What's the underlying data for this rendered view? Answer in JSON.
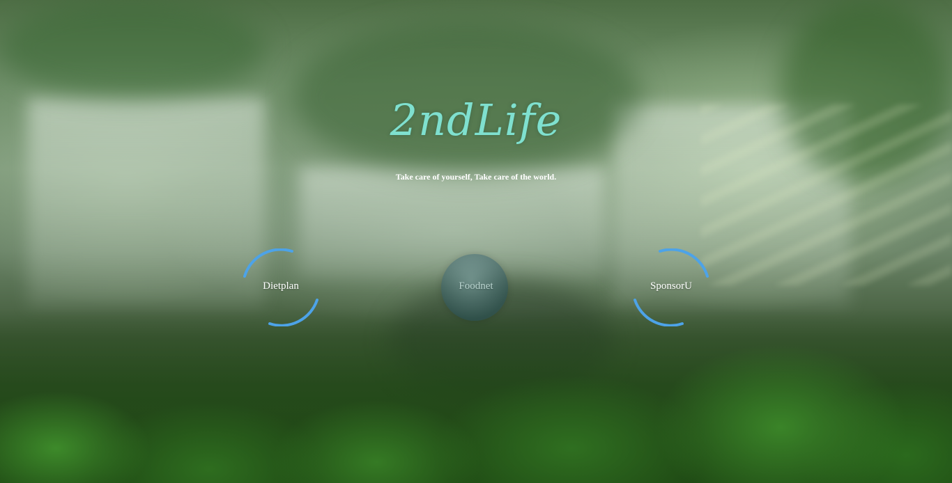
{
  "brand": {
    "logo_text": "2ndLife",
    "tagline": "Take care of yourself, Take care of the world."
  },
  "nav": {
    "items": [
      {
        "label": "Dietplan"
      },
      {
        "label": "Foodnet"
      },
      {
        "label": "SponsorU"
      }
    ]
  },
  "colors": {
    "logo": "#7fe0cf",
    "ring_accent": "#4da3e8",
    "text": "#ffffff"
  }
}
